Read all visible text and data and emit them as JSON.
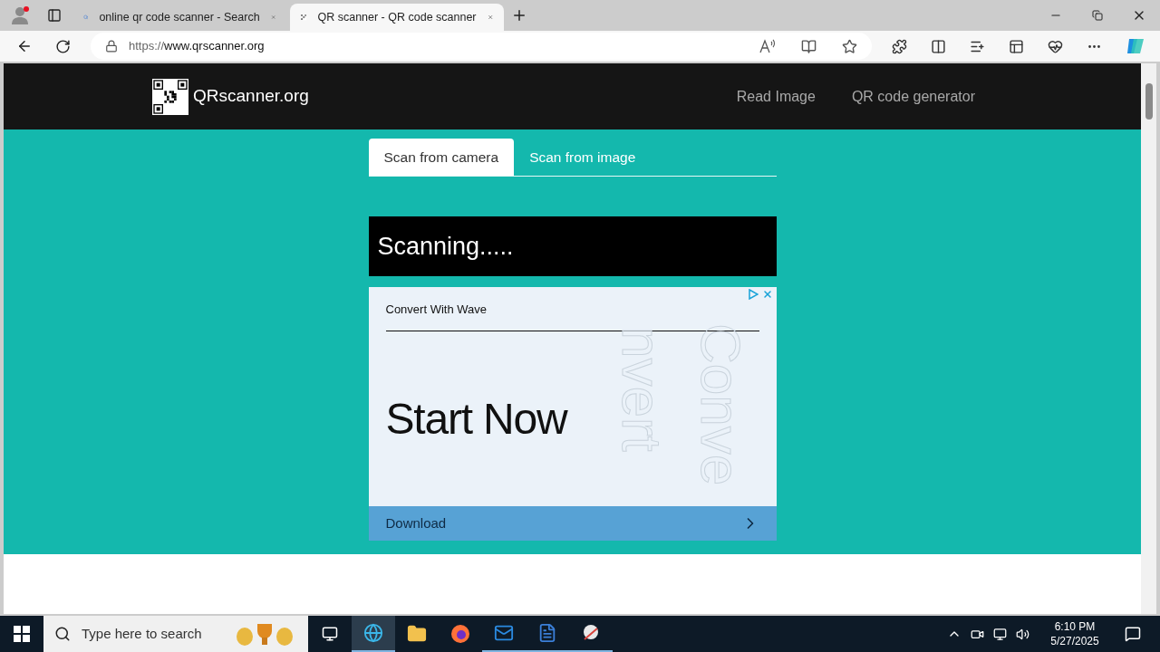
{
  "browser": {
    "tabs": [
      {
        "title": "online qr code scanner - Search",
        "selected": false
      },
      {
        "title": "QR scanner - QR code scanner",
        "selected": true
      }
    ],
    "url_scheme": "https://",
    "url_host": "www.qrscanner.org"
  },
  "site": {
    "logo": "QRscanner.org",
    "nav": [
      "Read Image",
      "QR code generator"
    ]
  },
  "scan_tabs": [
    {
      "label": "Scan from camera",
      "selected": true
    },
    {
      "label": "Scan from image",
      "selected": false
    }
  ],
  "status": "Scanning.....",
  "ad": {
    "brand": "Convert With Wave",
    "headline": "Start Now",
    "decor": [
      "nvert",
      "Conve"
    ],
    "cta": "Download"
  },
  "taskbar": {
    "search_placeholder": "Type here to search",
    "time": "6:10 PM",
    "date": "5/27/2025"
  }
}
